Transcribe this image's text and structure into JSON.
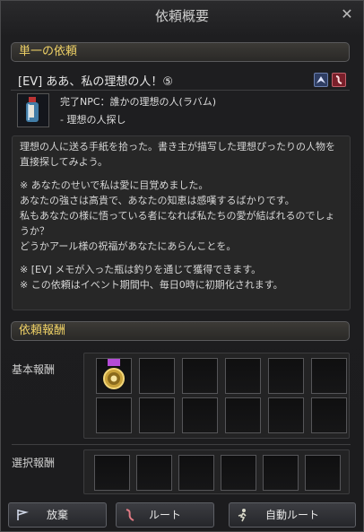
{
  "window": {
    "title": "依頼概要",
    "close_symbol": "✕"
  },
  "section_single": "単一の依頼",
  "quest": {
    "name": "[EV] ああ、私の理想の人！⑤",
    "completion_npc": "完了NPC：誰かの理想の人(ラバム)",
    "objective": "- 理想の人探し"
  },
  "description": {
    "p1": "理想の人に送る手紙を拾った。書き主が描写した理想ぴったりの人物を直接探してみよう。",
    "p2": "※ あなたのせいで私は愛に目覚めました。\nあなたの強さは高貴で、あなたの知恵は感嘆するばかりです。\n私もあなたの様に悟っている者になれば私たちの愛が結ばれるのでしょうか？\nどうかアール様の祝福があなたにあらんことを。",
    "p3": "※ [EV] メモが入った瓶は釣りを通じて獲得できます。\n※ この依頼はイベント期間中、毎日0時に初期化されます。"
  },
  "rewards": {
    "header": "依頼報酬",
    "basic_label": "基本報酬",
    "choice_label": "選択報酬",
    "basic_slots": [
      "medal-item",
      "empty",
      "empty",
      "empty",
      "empty",
      "empty",
      "empty",
      "empty",
      "empty",
      "empty",
      "empty",
      "empty"
    ],
    "choice_slots": [
      "empty",
      "empty",
      "empty",
      "empty",
      "empty",
      "empty"
    ]
  },
  "buttons": {
    "abandon": "放棄",
    "route": "ルート",
    "auto_route": "自動ルート"
  },
  "colors": {
    "section_text": "#f0d266",
    "background": "#1c1c1e"
  }
}
